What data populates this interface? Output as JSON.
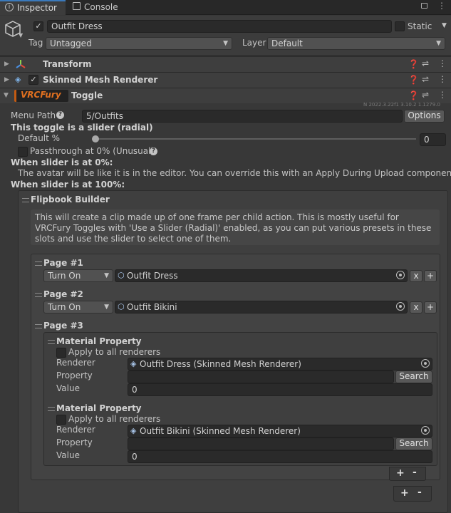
{
  "tabs": {
    "inspector": "Inspector",
    "console": "Console"
  },
  "object": {
    "name": "Outfit Dress",
    "static_label": "Static",
    "tag_label": "Tag",
    "tag_value": "Untagged",
    "layer_label": "Layer",
    "layer_value": "Default"
  },
  "components": {
    "transform": "Transform",
    "smr": "Skinned Mesh Renderer",
    "vrcfury_logo": "VRCFury",
    "toggle": "Toggle",
    "version": "N 2022.3.22f1 3.10.2 1.1279.0"
  },
  "toggle": {
    "menu_path_label": "Menu Path",
    "menu_path_value": "5/Outfits",
    "options": "Options",
    "slider_heading": "This toggle is a slider (radial)",
    "default_label": "Default %",
    "default_value": "0",
    "default_fraction": 0,
    "passthrough": "Passthrough at 0% (Unusual)",
    "at0_heading": "When slider is at 0%:",
    "at0_text": "The avatar will be like it is in the editor. You can override this with an Apply During Upload component.",
    "at100_heading": "When slider is at 100%:"
  },
  "flipbook": {
    "title": "Flipbook Builder",
    "help": "This will create a clip made up of one frame per child action. This is mostly useful for VRCFury Toggles with 'Use a Slider (Radial)' enabled, as you can put various presets in these slots and use the slider to select one of them.",
    "pages": [
      {
        "title": "Page #1",
        "action": "Turn On",
        "object": "Outfit Dress"
      },
      {
        "title": "Page #2",
        "action": "Turn On",
        "object": "Outfit Bikini"
      },
      {
        "title": "Page #3"
      }
    ],
    "material_props": [
      {
        "title": "Material Property",
        "apply_all": "Apply to all renderers",
        "renderer_label": "Renderer",
        "renderer": "Outfit Dress (Skinned Mesh Renderer)",
        "property_label": "Property",
        "search": "Search",
        "value_label": "Value",
        "value": "0"
      },
      {
        "title": "Material Property",
        "apply_all": "Apply to all renderers",
        "renderer_label": "Renderer",
        "renderer": "Outfit Bikini (Skinned Mesh Renderer)",
        "property_label": "Property",
        "search": "Search",
        "value_label": "Value",
        "value": "0"
      }
    ]
  },
  "buttons": {
    "x": "x",
    "plus": "+",
    "minus": "-"
  },
  "colors": {
    "background": "#383838",
    "vrcfury_badge": "#c25a12",
    "tab_active": "#3c3c3c"
  }
}
